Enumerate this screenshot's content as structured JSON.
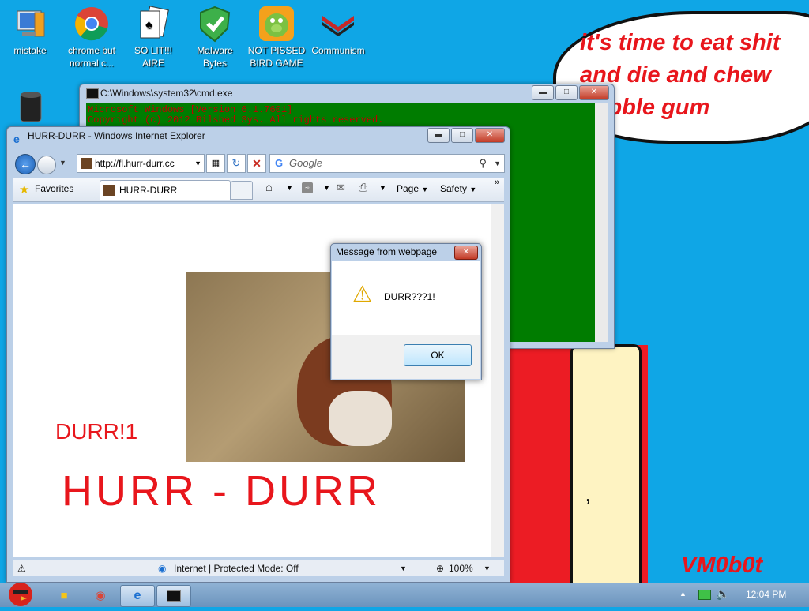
{
  "desktop": {
    "icons": [
      {
        "label": "mistake",
        "icon": "computer-icon"
      },
      {
        "label": "chrome but normal c...",
        "icon": "chrome-icon"
      },
      {
        "label": "SO LIT!!! AIRE",
        "icon": "solitaire-icon"
      },
      {
        "label": "Malware Bytes",
        "icon": "shield-icon"
      },
      {
        "label": "NOT PISSED BIRD GAME",
        "icon": "bird-game-icon"
      },
      {
        "label": "Communism",
        "icon": "flag-icon"
      }
    ],
    "bubble_lines": [
      "it's time to eat shit",
      "and die and chew",
      "bubble gum"
    ],
    "signature": "VM0b0t"
  },
  "cmd": {
    "title": "C:\\Windows\\system32\\cmd.exe",
    "lines": [
      "Microsoft Windows [Version 6.1.7601]",
      "Copyright (c) 2012 Bilshed Sys. All rights reserved."
    ]
  },
  "ie": {
    "title": "HURR-DURR - Windows Internet Explorer",
    "address": "http://fl.hurr-durr.cc",
    "search_placeholder": "Google",
    "favorites": "Favorites",
    "tab_label": "HURR-DURR",
    "menu": {
      "page": "Page",
      "safety": "Safety"
    },
    "content": {
      "small_text": "DURR!1",
      "big_text": "HURR - DURR"
    },
    "status": {
      "zone": "Internet | Protected Mode: Off",
      "zoom": "100%"
    }
  },
  "dialog": {
    "title": "Message from webpage",
    "message": "DURR???1!",
    "ok": "OK"
  },
  "taskbar": {
    "time": "12:04 PM"
  },
  "colors": {
    "desktop": "#0fa6e6",
    "red_text": "#e8161c",
    "cmd_bg": "#007c00"
  }
}
